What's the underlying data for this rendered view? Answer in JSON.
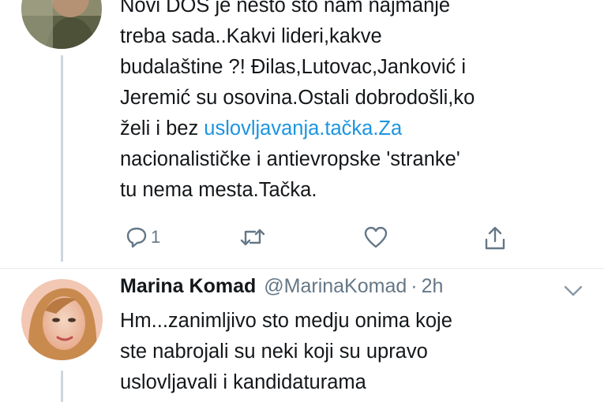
{
  "tweet1": {
    "lines": [
      {
        "text": "Novi DOS je nešto što nam najmanje"
      },
      {
        "text": "treba sada..Kakvi lideri,kakve"
      },
      {
        "text": "budalaštine ?! Đilas,Lutovac,Janković i"
      },
      {
        "text": "Jeremić su osovina.Ostali dobrodošli,ko"
      },
      {
        "text": "želi i bez ",
        "link": "uslovljavanja.tačka.Za"
      },
      {
        "text": "nacionalističke i antievropske 'stranke'"
      },
      {
        "text": "tu nema mesta.Tačka."
      }
    ],
    "actions": {
      "reply_icon": "reply-icon",
      "reply_count": "1",
      "retweet_icon": "retweet-icon",
      "like_icon": "heart-icon",
      "share_icon": "share-icon"
    }
  },
  "tweet2": {
    "name": "Marina Komad",
    "handle": "@MarinaKomad",
    "separator": "·",
    "time": "2h",
    "menu_icon": "chevron-down-icon",
    "lines": [
      {
        "text": "Hm...zanimljivo sto medju onima koje"
      },
      {
        "text": "ste nabrojali su neki koji su upravo"
      },
      {
        "text": "uslovljavali i kandidaturama"
      }
    ]
  },
  "colors": {
    "link": "#1b95e0",
    "secondary_text": "#657786",
    "thread_line": "#cdd6dd"
  }
}
